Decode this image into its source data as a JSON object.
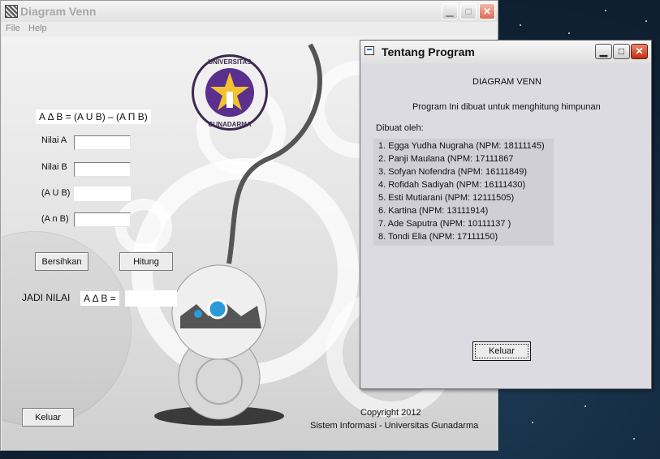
{
  "main_window": {
    "title": "Diagram Venn",
    "menu": [
      "File",
      "Help"
    ],
    "formula": "A Δ B = (A U B) – (A Π B)",
    "fields": {
      "nilai_a_label": "Nilai A",
      "nilai_b_label": "Nilai B",
      "union_label": "(A U B)",
      "intersect_label": "(A n B)",
      "nilai_a_value": "",
      "nilai_b_value": "",
      "union_value": "",
      "intersect_value": ""
    },
    "buttons": {
      "clear": "Bersihkan",
      "compute": "Hitung",
      "exit": "Keluar"
    },
    "result_label": "JADI NILAI",
    "result_formula": "A Δ B =",
    "result_value": "",
    "logo_text_top": "UNIVERSITAS",
    "logo_text_bottom": "GUNADARMA",
    "copyright": "Copyright 2012",
    "footer": "Sistem Informasi - Universitas Gunadarma"
  },
  "dialog": {
    "title": "Tentang Program",
    "heading": "DIAGRAM VENN",
    "description": "Program Ini dibuat untuk menghitung himpunan",
    "made_by": "Dibuat oleh:",
    "authors": [
      "1. Egga Yudha Nugraha (NPM: 18111145)",
      "2. Panji Maulana (NPM: 17111867",
      "3. Sofyan Nofendra (NPM: 16111849)",
      "4. Rofidah Sadiyah (NPM: 16111430)",
      "5. Esti Mutiarani (NPM: 12111505)",
      "6. Kartina (NPM: 13111914)",
      "7. Ade Saputra (NPM: 10111137 )",
      "8. Tondi Elia (NPM: 17111150)"
    ],
    "exit_button": "Keluar"
  },
  "colors": {
    "logo_purple": "#5b2f8e",
    "logo_gold": "#f2c230",
    "close_red": "#c22f10"
  }
}
